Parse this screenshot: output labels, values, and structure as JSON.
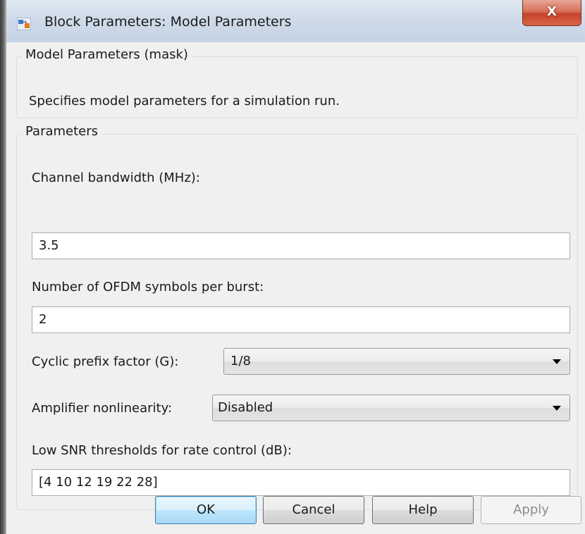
{
  "window": {
    "title": "Block Parameters: Model Parameters",
    "icon": "simulink-block-icon",
    "close_label": "X"
  },
  "description": {
    "group_title": "Model Parameters (mask)",
    "text": "Specifies model parameters for a simulation run."
  },
  "parameters": {
    "group_title": "Parameters",
    "channel_bandwidth": {
      "label": "Channel bandwidth (MHz):",
      "value": "3.5"
    },
    "ofdm_symbols": {
      "label": "Number of OFDM symbols per burst:",
      "value": "2"
    },
    "cyclic_prefix": {
      "label": "Cyclic prefix factor (G):",
      "value": "1/8"
    },
    "amplifier": {
      "label": "Amplifier nonlinearity:",
      "value": "Disabled"
    },
    "snr_thresholds": {
      "label": "Low SNR thresholds for rate control (dB):",
      "value": "[4 10 12 19 22 28]"
    }
  },
  "buttons": {
    "ok": "OK",
    "cancel": "Cancel",
    "help": "Help",
    "apply": "Apply"
  }
}
